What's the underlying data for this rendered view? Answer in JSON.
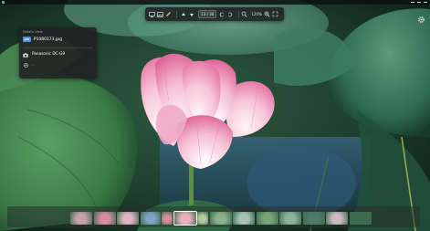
{
  "toolbar": {
    "counter": "13 / 30",
    "zoom": "120%",
    "icons": [
      "slideshow-icon",
      "gallery-icon",
      "edit-icon",
      "previous-icon",
      "next-icon",
      "rotate-left-icon",
      "rotate-right-icon",
      "zoom-out-icon",
      "zoom-in-icon",
      "fullscreen-icon"
    ]
  },
  "info_panel": {
    "title": "Details View",
    "file_type": "JPG",
    "file_name": "P1080173.jpg",
    "file_size": "",
    "dimensions": "",
    "camera_model": "Panasonic DC-G9",
    "lens": "",
    "exposure": ""
  },
  "filmstrip": {
    "thumbnail_count": 14,
    "active_index": 5,
    "colors": [
      "#c9a0ae",
      "#d98aa6",
      "#e0b4c2",
      "#7fa3c8",
      "#d78c9a",
      "#e8b1be",
      "#b8c8a0",
      "#8ab08f",
      "#a9c0ba",
      "#77a377",
      "#8fb39a",
      "#4d7a6a",
      "#ccb9c1",
      "#3d6b4e"
    ]
  },
  "colors": {
    "accent": "#4d8fd6",
    "petal": "#f3b5cc",
    "leaf": "#3f7f55"
  }
}
